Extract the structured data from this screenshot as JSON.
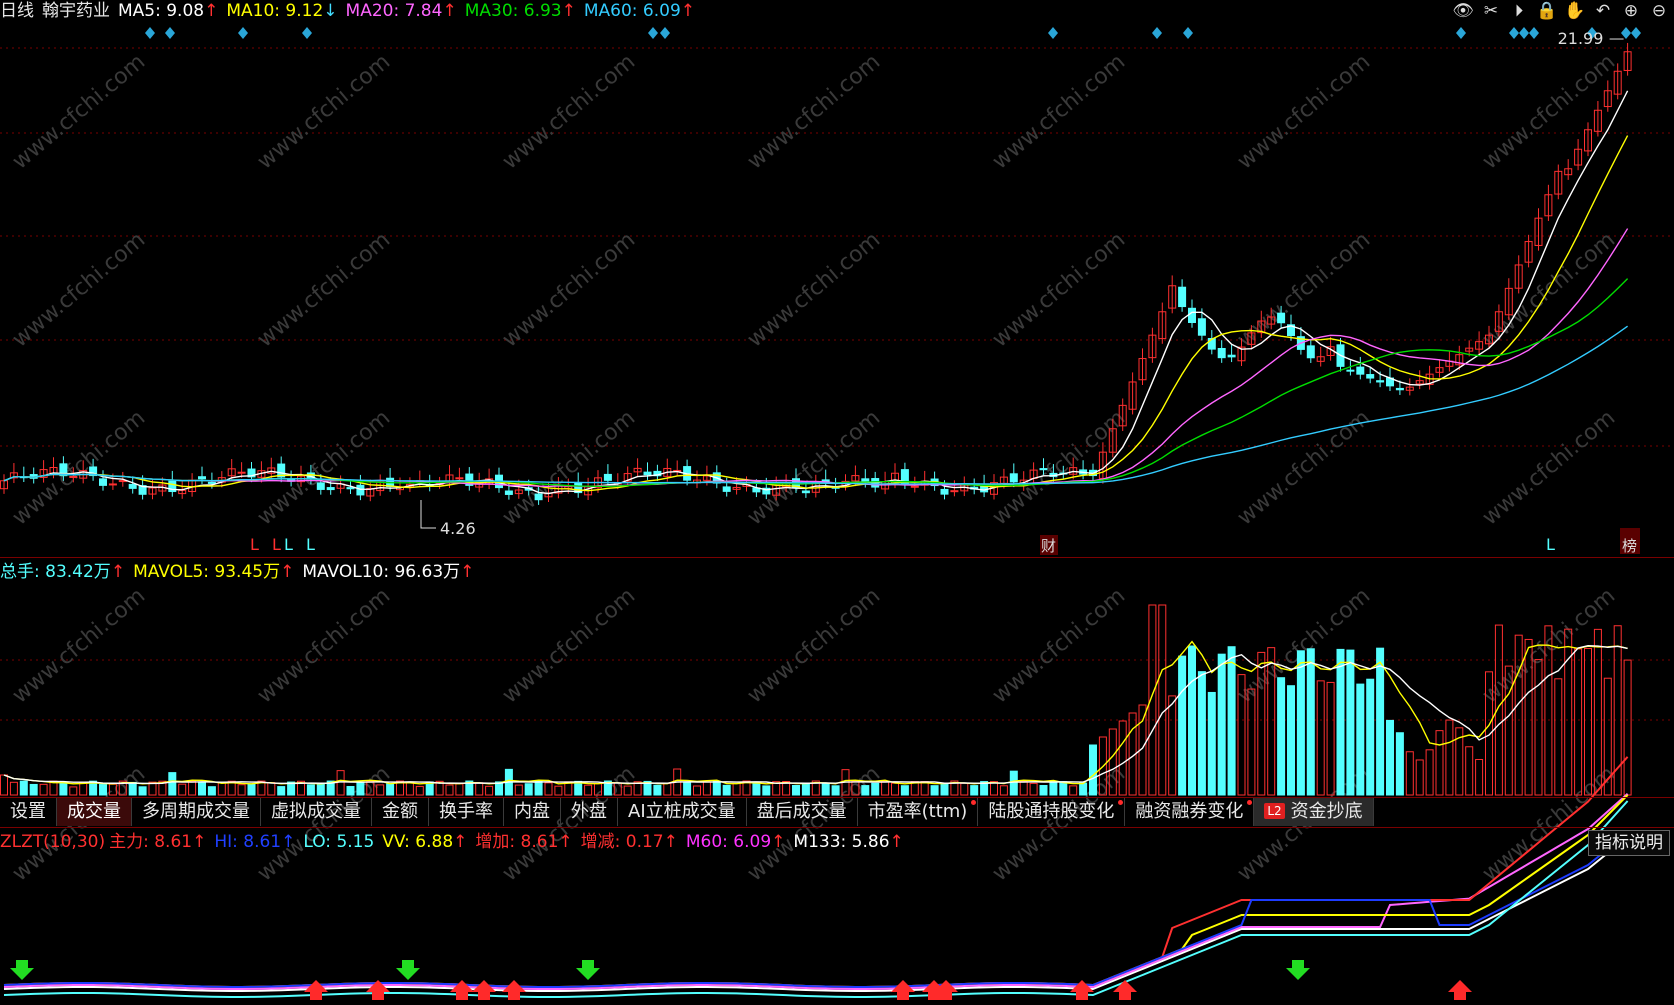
{
  "price_header": {
    "period": "日线",
    "stock_name": "翰宇药业",
    "ma5": "MA5: 9.08",
    "ma10": "MA10: 9.12",
    "ma20": "MA20: 7.84",
    "ma30": "MA30: 6.93",
    "ma60": "MA60: 6.09",
    "ma5_arrow": "↑",
    "ma10_arrow": "↓",
    "ma20_arrow": "↑",
    "ma30_arrow": "↑",
    "ma60_arrow": "↑"
  },
  "price_annotations": {
    "high_label": "21.99",
    "low_label": "4.26",
    "marker_l": "L",
    "marker_cai": "财",
    "marker_bang": "榜"
  },
  "volume_header": {
    "total": "总手: 83.42万",
    "mavol5": "MAVOL5: 93.45万",
    "mavol10": "MAVOL10: 96.63万",
    "arrow": "↑"
  },
  "tabs": [
    {
      "label": "设置",
      "active": false,
      "dot": false
    },
    {
      "label": "成交量",
      "active": true,
      "dot": false
    },
    {
      "label": "多周期成交量",
      "active": false,
      "dot": false
    },
    {
      "label": "虚拟成交量",
      "active": false,
      "dot": false
    },
    {
      "label": "金额",
      "active": false,
      "dot": false
    },
    {
      "label": "换手率",
      "active": false,
      "dot": false
    },
    {
      "label": "内盘",
      "active": false,
      "dot": false
    },
    {
      "label": "外盘",
      "active": false,
      "dot": false
    },
    {
      "label": "AI立桩成交量",
      "active": false,
      "dot": false
    },
    {
      "label": "盘后成交量",
      "active": false,
      "dot": false
    },
    {
      "label": "市盈率(ttm)",
      "active": false,
      "dot": true
    },
    {
      "label": "陆股通持股变化",
      "active": false,
      "dot": true
    },
    {
      "label": "融资融券变化",
      "active": false,
      "dot": true
    },
    {
      "label": "资金抄底",
      "active": false,
      "dot": false,
      "badge": "L2"
    }
  ],
  "indicator_header": {
    "name": "ZLZT(10,30)",
    "main": "主力: 8.61",
    "hi": "HI: 8.61",
    "lo": "LO: 5.15",
    "vv": "VV: 6.88",
    "add": "增加: 8.61",
    "change": "增减: 0.17",
    "m60": "M60: 6.09",
    "m133": "M133: 5.86",
    "arrow": "↑"
  },
  "indicator_button": "指标说明",
  "watermark": "www.cfchi.com",
  "colors": {
    "up": "#ff3030",
    "down": "#54ffff",
    "ma5": "#ffffff",
    "ma10": "#ffff00",
    "ma20": "#ff66ff",
    "ma30": "#00dd00",
    "ma60": "#33ccff",
    "grid": "#7a0000"
  },
  "icons": [
    "eye-icon",
    "scissors-icon",
    "play-icon",
    "lock-icon",
    "hand-icon",
    "undo-icon",
    "zoom-in-icon",
    "zoom-out-icon"
  ],
  "chart_data": {
    "type": "candlestick",
    "title": "翰宇药业 日线",
    "period_high": 21.99,
    "period_low": 4.26,
    "ma_last": {
      "MA5": 9.08,
      "MA10": 9.12,
      "MA20": 7.84,
      "MA30": 6.93,
      "MA60": 6.09
    },
    "volume_last": {
      "total_wan": 83.42,
      "MAVOL5_wan": 93.45,
      "MAVOL10_wan": 96.63
    },
    "indicator_last": {
      "主力": 8.61,
      "HI": 8.61,
      "LO": 5.15,
      "VV": 6.88,
      "增加": 8.61,
      "增减": 0.17,
      "M60": 6.09,
      "M133": 5.86
    }
  }
}
